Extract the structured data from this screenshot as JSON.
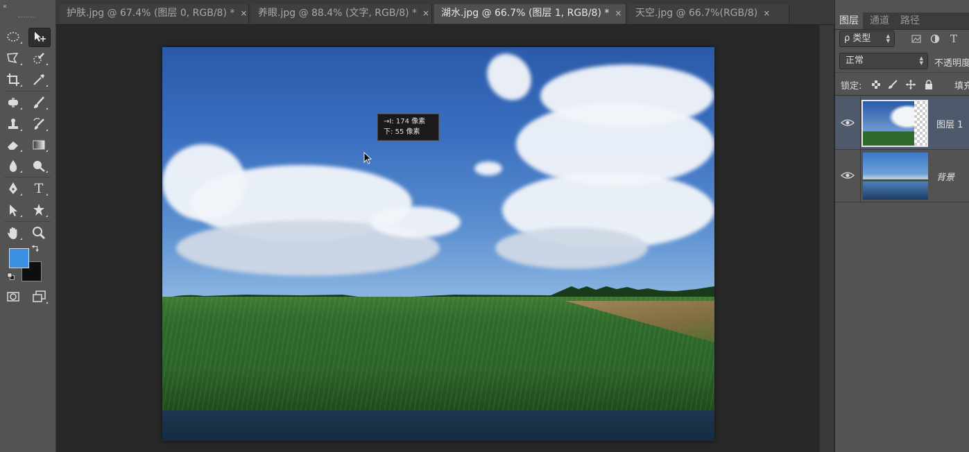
{
  "toolbar": {
    "collapse_glyph": "«",
    "tools": [
      {
        "name": "elliptical-marquee-icon"
      },
      {
        "name": "move-tool-icon",
        "active": true
      },
      {
        "name": "polygonal-lasso-icon"
      },
      {
        "name": "quick-selection-icon"
      },
      {
        "name": "crop-tool-icon"
      },
      {
        "name": "eyedropper-icon"
      },
      {
        "name": "spot-healing-icon"
      },
      {
        "name": "brush-tool-icon"
      },
      {
        "name": "clone-stamp-icon"
      },
      {
        "name": "history-brush-icon"
      },
      {
        "name": "eraser-icon"
      },
      {
        "name": "gradient-tool-icon"
      },
      {
        "name": "blur-tool-icon"
      },
      {
        "name": "dodge-tool-icon"
      },
      {
        "name": "pen-tool-icon"
      },
      {
        "name": "type-tool-icon"
      },
      {
        "name": "path-selection-icon"
      },
      {
        "name": "custom-shape-icon"
      },
      {
        "name": "hand-tool-icon"
      },
      {
        "name": "zoom-tool-icon"
      }
    ],
    "foreground_color": "#3b8fe0",
    "background_color": "#0e0e0e",
    "type_glyph": "T"
  },
  "tabs": [
    {
      "label": "护肤.jpg @ 67.4% (图层 0, RGB/8) *",
      "close": "×",
      "active": false
    },
    {
      "label": "养眼.jpg @ 88.4% (文字, RGB/8) *",
      "close": "×",
      "active": false
    },
    {
      "label": "湖水.jpg @ 66.7% (图层 1, RGB/8) *",
      "close": "×",
      "active": true
    },
    {
      "label": "天空.jpg @ 66.7%(RGB/8)",
      "close": "×",
      "active": false
    }
  ],
  "move_tooltip": {
    "line1_prefix": "→I:",
    "line1_value": "174 像素",
    "line2_prefix": "下:",
    "line2_value": "55 像素"
  },
  "panel": {
    "tabs": [
      "图层",
      "通道",
      "路径"
    ],
    "filter_label": "ρ 类型",
    "blend_mode": "正常",
    "opacity_label": "不透明度",
    "lock_label": "锁定:",
    "fill_label": "填充",
    "filter_type_glyph": "T",
    "layers": [
      {
        "name": "图层 1",
        "selected": true,
        "italic": false
      },
      {
        "name": "背景",
        "selected": false,
        "italic": true
      }
    ]
  }
}
